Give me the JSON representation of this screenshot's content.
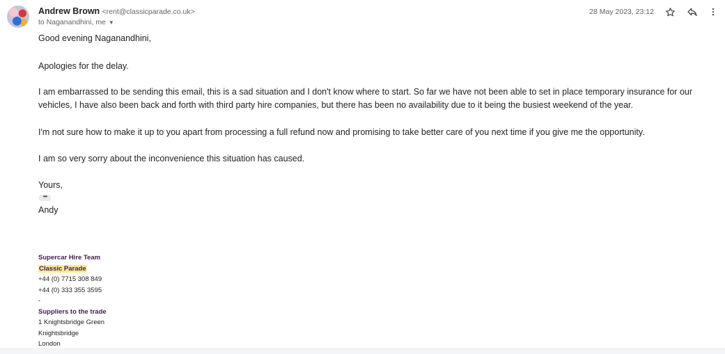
{
  "header": {
    "sender_name": "Andrew Brown",
    "sender_email": "<rent@classicparade.co.uk>",
    "recipients": "to Naganandhini, me",
    "date": "28 May 2023, 23:12",
    "star_icon": "star-icon",
    "reply_icon": "reply-icon",
    "more_icon": "more-vert-icon"
  },
  "body": {
    "greeting": "Good evening Naganandhini,",
    "apology": "Apologies for the delay.",
    "para1": "I am embarrassed to be sending this email, this is a sad situation and I don't know where to start. So far we have not been able to set in place temporary insurance for our vehicles, I have also been back and forth with third party hire companies, but there has been no availability due to it being the busiest weekend of the year.",
    "para2": "I'm not sure how to make it up to you apart from processing a full refund now and promising to take better care of you next time if you give me the opportunity.",
    "para3": "I am so very sorry about the inconvenience this situation has caused.",
    "closing": "Yours,",
    "ellipsis": "•••",
    "signoff": "Andy"
  },
  "signature": {
    "team": "Supercar Hire Team",
    "company": "Classic Parade",
    "phone1": "+44 (0) 7715 308 849",
    "phone2": "+44 (0) 333 355 3595",
    "dash": "-",
    "suppliers": "Suppliers to the trade",
    "address1": "1 Knightsbridge Green",
    "address2": "Knightsbridge",
    "address3": "London"
  },
  "colors": {
    "signature_accent": "#3d1f4a",
    "highlight": "#fbe79a",
    "meta_text": "#5f6368"
  }
}
